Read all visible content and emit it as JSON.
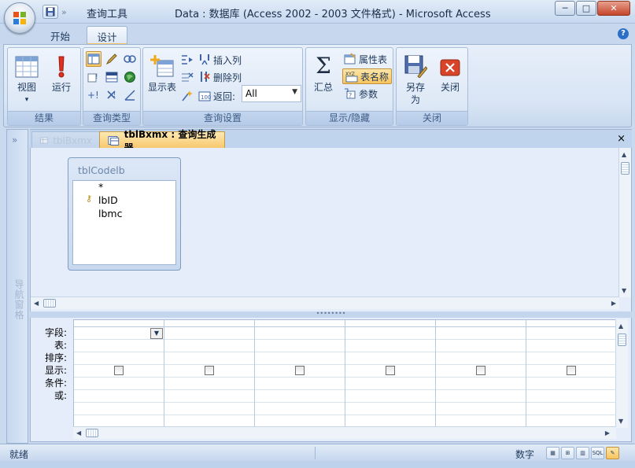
{
  "window": {
    "context_tab": "查询工具",
    "title": "Data : 数据库 (Access 2002 - 2003 文件格式) - Microsoft Access",
    "minimize": "─",
    "maximize": "□",
    "close": "✕"
  },
  "ribbon": {
    "tabs": [
      "开始",
      "设计"
    ],
    "active_tab": "设计",
    "groups": {
      "results": {
        "label": "结果",
        "view": "视图",
        "view_arrow": "▾",
        "run": "运行"
      },
      "query_type": {
        "label": "查询类型"
      },
      "query_setup": {
        "label": "查询设置",
        "show_table": "显示表",
        "insert_column": "插入列",
        "delete_column": "删除列",
        "return_label": "返回:",
        "return_value": "All"
      },
      "show_hide": {
        "label": "显示/隐藏",
        "totals": "汇总",
        "property_sheet": "属性表",
        "table_names": "表名称",
        "parameters": "参数"
      },
      "close": {
        "label": "关闭",
        "save_as": "另存为",
        "close": "关闭"
      }
    }
  },
  "nav_pane": {
    "toggle": "»",
    "label": "导航窗格"
  },
  "doc_tabs": [
    {
      "label": "tblBxmx",
      "active": false
    },
    {
      "label": "tblBxmx : 查询生成器",
      "active": true
    }
  ],
  "doc_close": "×",
  "design": {
    "table": {
      "name": "tblCodelb",
      "fields": [
        "*",
        "lbID",
        "lbmc"
      ],
      "key_field": "lbID"
    }
  },
  "grid": {
    "row_labels": [
      "字段:",
      "表:",
      "排序:",
      "显示:",
      "条件:",
      "或:"
    ],
    "columns": 6
  },
  "status": {
    "left": "就绪",
    "mode": "数字"
  },
  "colors": {
    "accent": "#f9c45d",
    "ribbon_bg": "#dde8f6",
    "title_text": "#1a2d4a"
  }
}
